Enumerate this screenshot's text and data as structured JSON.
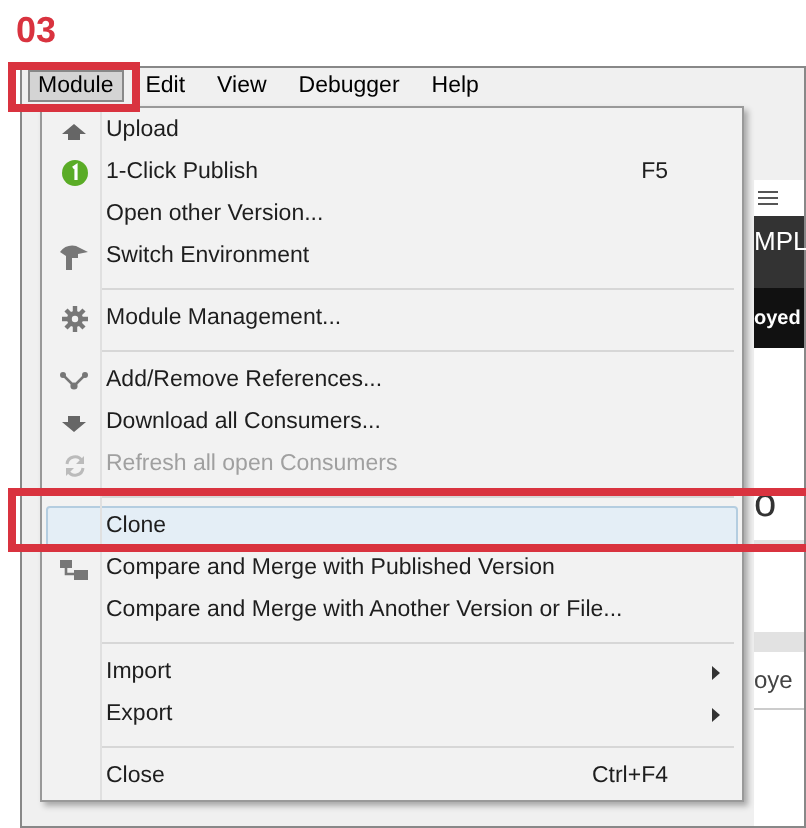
{
  "step_label": "03",
  "menubar": [
    {
      "label": "Module",
      "selected": true
    },
    {
      "label": "Edit",
      "selected": false
    },
    {
      "label": "View",
      "selected": false
    },
    {
      "label": "Debugger",
      "selected": false
    },
    {
      "label": "Help",
      "selected": false
    }
  ],
  "background": {
    "heading_fragment": "MPL",
    "band_fragment": "oyed",
    "title_fragment": "o",
    "row_fragment": "oye"
  },
  "menu": [
    {
      "kind": "item",
      "label": "Upload",
      "disabled": false,
      "selected": false
    },
    {
      "kind": "item",
      "label": "1-Click Publish",
      "shortcut": "F5",
      "disabled": false,
      "selected": false
    },
    {
      "kind": "item",
      "label": "Open other Version...",
      "disabled": false,
      "selected": false
    },
    {
      "kind": "item",
      "label": "Switch Environment",
      "disabled": false,
      "selected": false
    },
    {
      "kind": "separator"
    },
    {
      "kind": "item",
      "label": "Module Management...",
      "disabled": false,
      "selected": false
    },
    {
      "kind": "separator"
    },
    {
      "kind": "item",
      "label": "Add/Remove References...",
      "disabled": false,
      "selected": false
    },
    {
      "kind": "item",
      "label": "Download all Consumers...",
      "disabled": false,
      "selected": false
    },
    {
      "kind": "item",
      "label": "Refresh all open Consumers",
      "disabled": true,
      "selected": false
    },
    {
      "kind": "separator"
    },
    {
      "kind": "item",
      "label": "Clone",
      "disabled": false,
      "selected": true
    },
    {
      "kind": "item",
      "label": "Compare and Merge with Published Version",
      "disabled": false,
      "selected": false
    },
    {
      "kind": "item",
      "label": "Compare and Merge with Another Version or File...",
      "disabled": false,
      "selected": false
    },
    {
      "kind": "separator"
    },
    {
      "kind": "submenu",
      "label": "Import",
      "disabled": false,
      "selected": false
    },
    {
      "kind": "submenu",
      "label": "Export",
      "disabled": false,
      "selected": false
    },
    {
      "kind": "separator"
    },
    {
      "kind": "item",
      "label": "Close",
      "shortcut": "Ctrl+F4",
      "disabled": false,
      "selected": false
    }
  ]
}
